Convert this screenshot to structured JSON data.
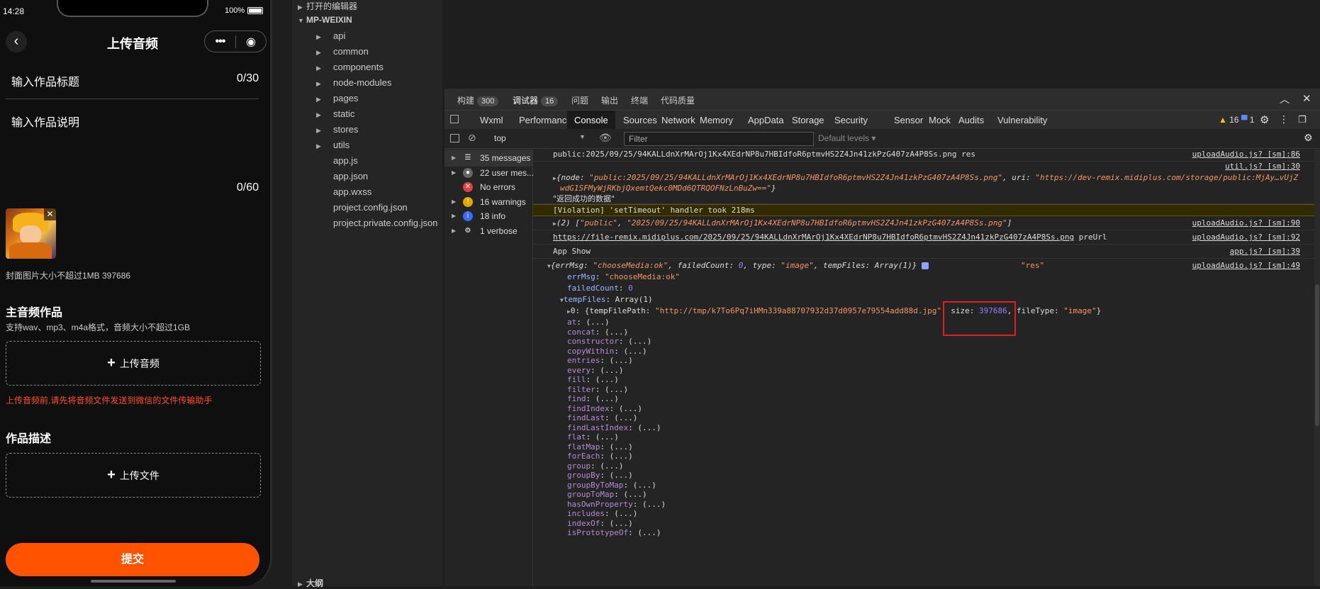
{
  "phone": {
    "time": "14:28",
    "battery": "100%",
    "title": "上传音频",
    "back_icon": "‹",
    "title_field": {
      "placeholder": "输入作品标题",
      "count": "0/30"
    },
    "desc_field": {
      "placeholder": "输入作品说明",
      "count": "0/60"
    },
    "cover_note": "封面图片大小不超过1MB 397686",
    "main_audio_heading": "主音频作品",
    "audio_formats": "支持wav、mp3、m4a格式，音频大小不超过1GB",
    "upload_audio_label": "上传音频",
    "upload_warning": "上传音频前,请先将音频文件发送到微信的文件传输助手",
    "desc_heading": "作品描述",
    "upload_file_label": "上传文件",
    "submit_label": "提交",
    "accent_color": "#ff5300"
  },
  "tree": {
    "open_editors": "打开的编辑器",
    "project": "MP-WEIXIN",
    "folders": [
      "api",
      "common",
      "components",
      "node-modules",
      "pages",
      "static",
      "stores",
      "utils"
    ],
    "files": [
      "app.js",
      "app.json",
      "app.wxss",
      "project.config.json",
      "project.private.config.json"
    ],
    "outline": "大纲"
  },
  "devtools": {
    "top_tabs": [
      {
        "label": "构建",
        "badge": "300"
      },
      {
        "label": "调试器",
        "badge": "16"
      },
      {
        "label": "问题"
      },
      {
        "label": "输出"
      },
      {
        "label": "终端"
      },
      {
        "label": "代码质量"
      }
    ],
    "panels": [
      "Wxml",
      "Performance",
      "Console",
      "Sources",
      "Network",
      "Memory",
      "AppData",
      "Storage",
      "Security",
      "Sensor",
      "Mock",
      "Audits",
      "Vulnerability"
    ],
    "active_panel": "Console",
    "warn_count": "16",
    "info_count": "1",
    "context": "top",
    "filter_placeholder": "Filter",
    "levels": "Default levels",
    "sidebar": [
      {
        "icon": "list-icon",
        "label": "35 messages"
      },
      {
        "icon": "user-icon",
        "label": "22 user mes..."
      },
      {
        "icon": "error-icon",
        "label": "No errors"
      },
      {
        "icon": "warning-icon",
        "label": "16 warnings"
      },
      {
        "icon": "info-icon",
        "label": "18 info"
      },
      {
        "icon": "gear-icon",
        "label": "1 verbose"
      }
    ]
  },
  "console": {
    "l1_text": "public:2025/09/25/94KALLdnXrMArOj1Kx4XEdrNP8u7HBIdfoR6ptmvHS2Z4Jn41zkPzG407zA4P8Ss.png res",
    "l1_src": "uploadAudio.js? [sm]:86",
    "l2_src": "util.js? [sm]:30",
    "l2_a": "{node: ",
    "l2_node": "\"public:2025/09/25/94KALLdnXrMArOj1Kx4XEdrNP8u7HBIdfoR6ptmvHS2Z4Jn41zkPzG407zA4P8Ss.png\"",
    "l2_b": ", uri: ",
    "l2_uri1": "\"https://dev-remix.midiplus.com/storage/public:MjAy…vUjZ",
    "l2_uri2": "wdG1SFMyWjRKbjQxemtQekc0MDd6QTRQOFNzLnBuZw==\"",
    "l2_c": "}",
    "l2_msg": "\"返回成功的数据\"",
    "violation": "[Violation] 'setTimeout' handler took 218ms",
    "l4_a": "(2) [",
    "l4_s1": "\"public\"",
    "l4_s2": "\"2025/09/25/94KALLdnXrMArOj1Kx4XEdrNP8u7HBIdfoR6ptmvHS2Z4Jn41zkPzG407zA4P8Ss.png\"",
    "l4_b": "]",
    "l4_src": "uploadAudio.js? [sm]:90",
    "l5_link": "https://file-remix.midiplus.com/2025/09/25/94KALLdnXrMArOj1Kx4XEdrNP8u7HBIdfoR6ptmvHS2Z4Jn41zkPzG407zA4P8Ss.png",
    "l5_tail": " preUrl",
    "l5_src": "uploadAudio.js? [sm]:92",
    "l6_text": "App Show",
    "l6_src": "app.js? [sm]:39",
    "l7_a": "{errMsg: ",
    "l7_errmsg": "\"chooseMedia:ok\"",
    "l7_b": ", failedCount: ",
    "l7_fc": "0",
    "l7_c": ", type: ",
    "l7_type": "\"image\"",
    "l7_d": ", tempFiles: Array(1)}",
    "l7_res": "\"res\"",
    "l7_src": "uploadAudio.js? [sm]:49",
    "errMsg_key": "errMsg",
    "errMsg_val": "\"chooseMedia:ok\"",
    "failedCount_key": "failedCount",
    "failedCount_val": "0",
    "tempFiles_key": "tempFiles",
    "tempFiles_val": ": Array(1)",
    "item0_a": "0: {tempFilePath: ",
    "item0_path": "\"http://tmp/k7To6Pq7iHMn339a88707932d37d0957e79554add88d.jpg\"",
    "item0_b": ", size: ",
    "item0_size": "397686",
    "item0_c": ", fileType: ",
    "item0_type": "\"image\"",
    "item0_d": "}",
    "methods": [
      "at",
      "concat",
      "constructor",
      "copyWithin",
      "entries",
      "every",
      "fill",
      "filter",
      "find",
      "findIndex",
      "findLast",
      "findLastIndex",
      "flat",
      "flatMap",
      "forEach",
      "group",
      "groupBy",
      "groupByToMap",
      "groupToMap",
      "hasOwnProperty",
      "includes",
      "indexOf",
      "isPrototypeOf"
    ],
    "method_value": ": (...)"
  }
}
